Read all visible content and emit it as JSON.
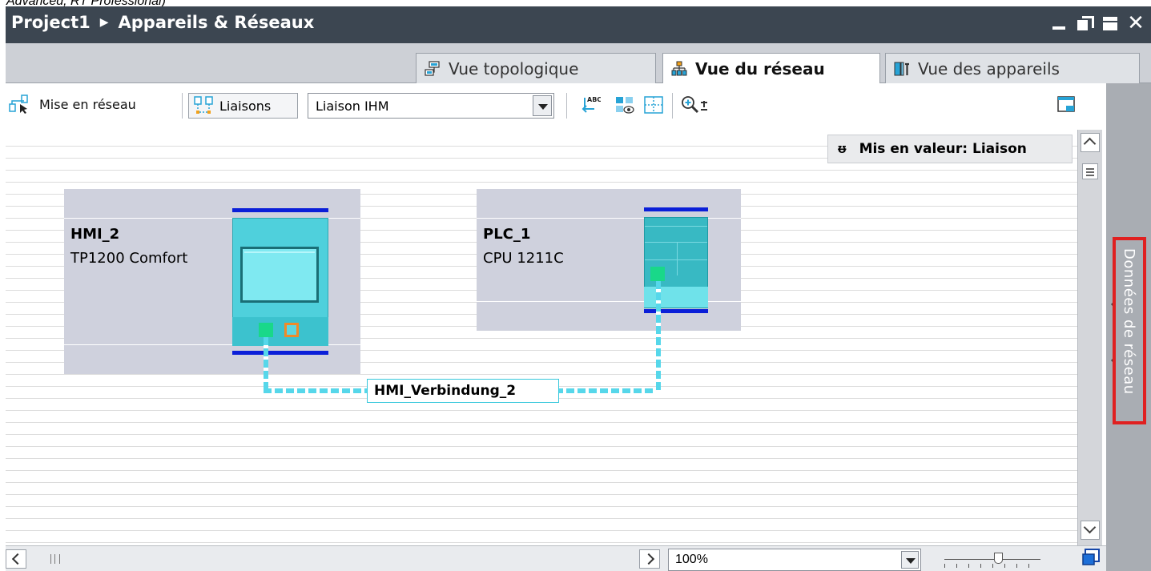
{
  "caption": "Advanced, RT Professional)",
  "titlebar": {
    "project": "Project1",
    "separator": "▶",
    "section": "Appareils & Réseaux",
    "close_glyph": "✕"
  },
  "tabs": [
    {
      "label": "Vue topologique",
      "icon": "topology-icon",
      "active": false
    },
    {
      "label": "Vue du réseau",
      "icon": "network-icon",
      "active": true
    },
    {
      "label": "Vue des appareils",
      "icon": "devices-icon",
      "active": false
    }
  ],
  "toolbar": {
    "networking_label": "Mise en réseau",
    "connections_label": "Liaisons",
    "connection_type": "Liaison IHM"
  },
  "highlight": {
    "pin_glyph": "ᵿ",
    "label": "Mis en valeur: Liaison"
  },
  "devices": {
    "hmi": {
      "name": "HMI_2",
      "model": "TP1200 Comfort"
    },
    "plc": {
      "name": "PLC_1",
      "model": "CPU 1211C"
    }
  },
  "connection": {
    "label": "HMI_Verbindung_2"
  },
  "side_panel": {
    "label": "Données de réseau"
  },
  "statusbar": {
    "zoom": "100%"
  },
  "colors": {
    "title_bg": "#3c4651",
    "device_bg": "#cfd1dd",
    "hmi_cyan": "#4fd0dc",
    "port_green": "#19d889",
    "port_orange": "#f08a28",
    "bus_blue": "#0b1fd8",
    "connection_cyan": "#56d7ea",
    "highlight_red": "#e02020"
  }
}
